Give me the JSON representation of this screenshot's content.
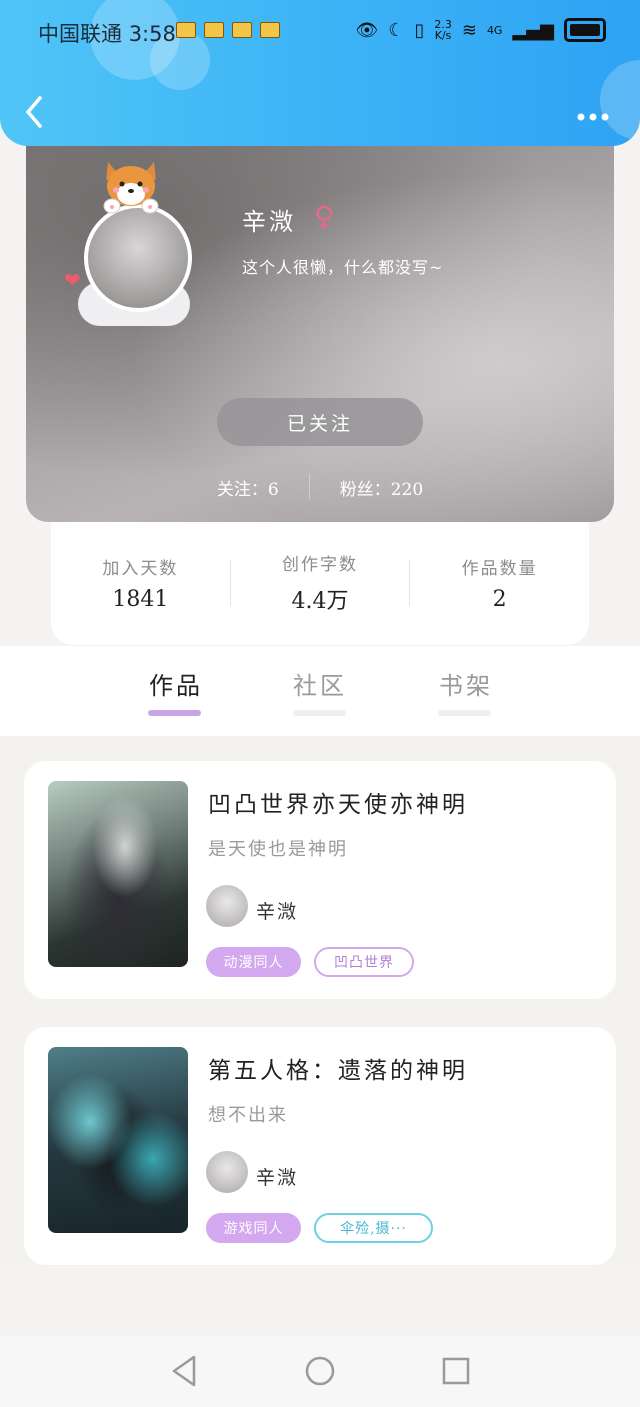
{
  "status_bar": {
    "carrier": "中国联通",
    "time": "3:58",
    "network_speed_top": "2.3",
    "network_speed_bottom": "K/s",
    "network_type": "4G"
  },
  "header": {
    "back_icon": "chevron-left-icon",
    "more_icon": "more-dots-icon"
  },
  "profile": {
    "name": "辛溦",
    "gender_symbol": "♀",
    "bio": "这个人很懒，什么都没写~",
    "follow_button_label": "已关注",
    "following_label": "关注：6",
    "followers_label": "粉丝：220"
  },
  "stats": [
    {
      "label": "加入天数",
      "value": "1841"
    },
    {
      "label": "创作字数",
      "value": "4.4万"
    },
    {
      "label": "作品数量",
      "value": "2"
    }
  ],
  "tabs": [
    {
      "label": "作品",
      "active": true
    },
    {
      "label": "社区",
      "active": false
    },
    {
      "label": "书架",
      "active": false
    }
  ],
  "works": [
    {
      "title": "凹凸世界亦天使亦神明",
      "description": "是天使也是神明",
      "author": "辛溦",
      "tags": [
        "动漫同人",
        "凹凸世界"
      ]
    },
    {
      "title": "第五人格：遗落的神明",
      "description": "想不出来",
      "author": "辛溦",
      "tags": [
        "游戏同人",
        "伞殓,摄···"
      ]
    }
  ],
  "colors": {
    "header_blue": "#3ab0f6",
    "tag_purple": "#d3a8ef",
    "tag_blue": "#6fcfe6",
    "tab_indicator": "#c8a6e6"
  }
}
